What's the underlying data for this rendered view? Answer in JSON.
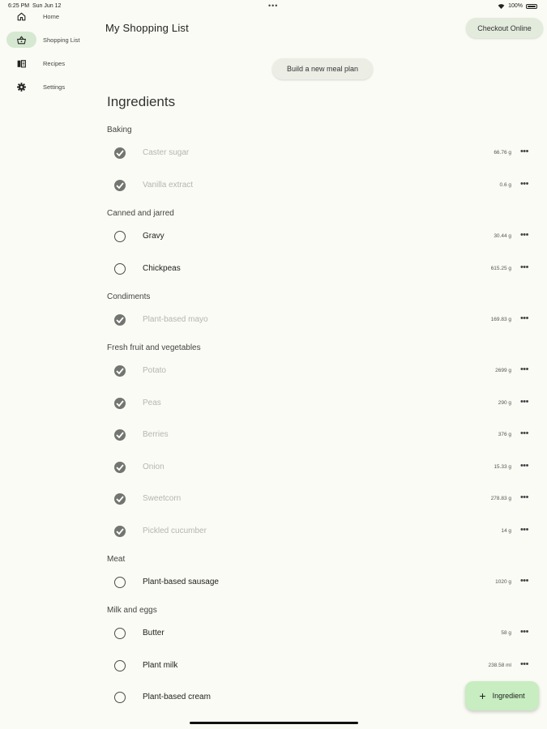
{
  "status_bar": {
    "time": "6:25 PM",
    "date": "Sun Jun 12",
    "dots": "•••",
    "battery": "100%"
  },
  "nav": {
    "items": [
      {
        "label": "Home",
        "icon": "home-icon"
      },
      {
        "label": "Shopping List",
        "icon": "basket-icon",
        "active": true
      },
      {
        "label": "Recipes",
        "icon": "book-icon"
      },
      {
        "label": "Settings",
        "icon": "gear-icon"
      }
    ]
  },
  "header": {
    "title": "My Shopping List",
    "checkout_label": "Checkout Online",
    "meal_plan_label": "Build a new meal plan"
  },
  "ingredients": {
    "title": "Ingredients",
    "categories": [
      {
        "name": "Baking",
        "items": [
          {
            "name": "Caster sugar",
            "qty": "66.76 g",
            "checked": true
          },
          {
            "name": "Vanilla extract",
            "qty": "0.6 g",
            "checked": true
          }
        ]
      },
      {
        "name": "Canned and jarred",
        "items": [
          {
            "name": "Gravy",
            "qty": "30.44 g",
            "checked": false
          },
          {
            "name": "Chickpeas",
            "qty": "615.25 g",
            "checked": false
          }
        ]
      },
      {
        "name": "Condiments",
        "items": [
          {
            "name": "Plant-based mayo",
            "qty": "169.83 g",
            "checked": true
          }
        ]
      },
      {
        "name": "Fresh fruit and vegetables",
        "items": [
          {
            "name": "Potato",
            "qty": "2699 g",
            "checked": true
          },
          {
            "name": "Peas",
            "qty": "290 g",
            "checked": true
          },
          {
            "name": "Berries",
            "qty": "376 g",
            "checked": true
          },
          {
            "name": "Onion",
            "qty": "15.33 g",
            "checked": true
          },
          {
            "name": "Sweetcorn",
            "qty": "278.83 g",
            "checked": true
          },
          {
            "name": "Pickled cucumber",
            "qty": "14 g",
            "checked": true
          }
        ]
      },
      {
        "name": "Meat",
        "items": [
          {
            "name": "Plant-based sausage",
            "qty": "1020 g",
            "checked": false
          }
        ]
      },
      {
        "name": "Milk and eggs",
        "items": [
          {
            "name": "Butter",
            "qty": "58 g",
            "checked": false
          },
          {
            "name": "Plant milk",
            "qty": "238.58 ml",
            "checked": false
          },
          {
            "name": "Plant-based cream",
            "qty": "",
            "checked": false
          }
        ]
      }
    ]
  },
  "fab": {
    "label": "Ingredient",
    "icon": "plus-icon"
  },
  "colors": {
    "background": "#fafbf4",
    "accent": "#c7edc1",
    "active_nav": "#d6e8d1",
    "checked": "#737571"
  }
}
